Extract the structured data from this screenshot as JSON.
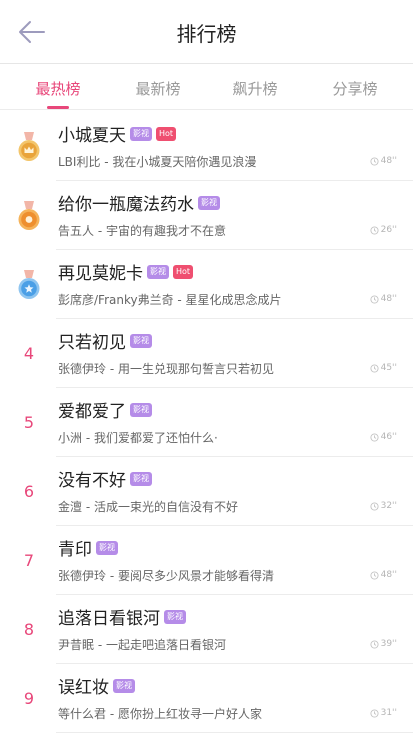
{
  "header": {
    "title": "排行榜"
  },
  "tabs": [
    {
      "label": "最热榜",
      "active": true
    },
    {
      "label": "最新榜",
      "active": false
    },
    {
      "label": "飙升榜",
      "active": false
    },
    {
      "label": "分享榜",
      "active": false
    }
  ],
  "colors": {
    "accent": "#e8477a",
    "badge_tag": "#b58ce8",
    "badge_hot": "#ef4f70"
  },
  "rows": [
    {
      "rank": "1",
      "medal": "gold-medal-icon",
      "name": "小城夏天",
      "tag": "影视",
      "hot": "Hot",
      "subtitle": "LBI利比 - 我在小城夏天陪你遇见浪漫",
      "duration": "48''"
    },
    {
      "rank": "2",
      "medal": "silver-medal-icon",
      "name": "给你一瓶魔法药水",
      "tag": "影视",
      "hot": null,
      "subtitle": "告五人 - 宇宙的有趣我才不在意",
      "duration": "26''"
    },
    {
      "rank": "3",
      "medal": "bronze-medal-icon",
      "name": "再见莫妮卡",
      "tag": "影视",
      "hot": "Hot",
      "subtitle": "彭席彦/Franky弗兰奇 - 星星化成思念成片",
      "duration": "48''"
    },
    {
      "rank": "4",
      "medal": null,
      "name": "只若初见",
      "tag": "影视",
      "hot": null,
      "subtitle": "张德伊玲 - 用一生兑现那句誓言只若初见",
      "duration": "45''"
    },
    {
      "rank": "5",
      "medal": null,
      "name": "爱都爱了",
      "tag": "影视",
      "hot": null,
      "subtitle": "小洲 - 我们爱都爱了还怕什么·",
      "duration": "46''"
    },
    {
      "rank": "6",
      "medal": null,
      "name": "没有不好",
      "tag": "影视",
      "hot": null,
      "subtitle": "金澶 - 活成一束光的自信没有不好",
      "duration": "32''"
    },
    {
      "rank": "7",
      "medal": null,
      "name": "青印",
      "tag": "影视",
      "hot": null,
      "subtitle": "张德伊玲 - 要阅尽多少风景才能够看得清",
      "duration": "48''"
    },
    {
      "rank": "8",
      "medal": null,
      "name": "追落日看银河",
      "tag": "影视",
      "hot": null,
      "subtitle": "尹昔眠 - 一起走吧追落日看银河",
      "duration": "39''"
    },
    {
      "rank": "9",
      "medal": null,
      "name": "误红妆",
      "tag": "影视",
      "hot": null,
      "subtitle": "等什么君 - 愿你扮上红妆寻一户好人家",
      "duration": "31''"
    }
  ]
}
